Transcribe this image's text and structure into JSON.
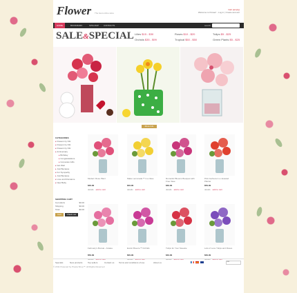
{
  "header": {
    "logo": "Flower",
    "tagline": "The best online store",
    "cart_link": "Cart (empty)",
    "welcome": "Welcome to Flower! - Log in | Create account"
  },
  "nav": {
    "items": [
      "HOME",
      "BOOKMARK",
      "SITE MAP",
      "CONTACTS"
    ],
    "search_label": "search"
  },
  "promo": {
    "title_left": "SALE",
    "ampersand": "&",
    "title_right": "SPECIAL",
    "col1": [
      {
        "label": "Lilies",
        "range": "$15 - $30"
      },
      {
        "label": "Orchids",
        "range": "$35 - $99"
      }
    ],
    "col2": [
      {
        "label": "Roses",
        "range": "$10 - $20"
      },
      {
        "label": "Tropical",
        "range": "$50 - $50"
      }
    ],
    "col3": [
      {
        "label": "Tulips",
        "range": "$5 - $25"
      },
      {
        "label": "Green Plants",
        "range": "$5 - $25"
      }
    ],
    "more_label": "More Info"
  },
  "sidebar": {
    "categories_title": "CATEGORIES",
    "categories": [
      {
        "label": "Flowers by Nbr",
        "sub": false
      },
      {
        "label": "Flowers by Nbr",
        "sub": false
      },
      {
        "label": "Flowers by Nbr",
        "sub": false
      },
      {
        "label": "Anniversary",
        "sub": false
      },
      {
        "label": "Birthday",
        "sub": true
      },
      {
        "label": "Congratulations",
        "sub": true
      },
      {
        "label": "Corporate Gifts",
        "sub": true
      },
      {
        "label": "Get Well",
        "sub": false
      },
      {
        "label": "Just Because",
        "sub": false
      },
      {
        "label": "For Sympathy",
        "sub": false
      },
      {
        "label": "Just Because",
        "sub": false
      },
      {
        "label": "Love and Romance",
        "sub": false
      },
      {
        "label": "New Baby",
        "sub": false
      }
    ],
    "cart_title": "SHOPPING CART",
    "cart_rows": [
      {
        "label": "0 products",
        "value": "$0.00"
      },
      {
        "label": "Shipping",
        "value": "$0.00"
      },
      {
        "label": "Total",
        "value": "$0.00"
      }
    ],
    "cart_btn": "Cart",
    "checkout_btn": "Check out"
  },
  "products": [
    {
      "name": "Modern Rose Plant",
      "price": "$29.99",
      "flowers": "#e0507a"
    },
    {
      "name": "Make Lemonade™ in a Vase",
      "price": "$49.99",
      "flowers": "#f2cf33"
    },
    {
      "name": "Romantic Blooms Bouquet with Free Vase",
      "price": "$39.99",
      "flowers": "#c8357a"
    },
    {
      "name": "Pink Gerbera in a Jeweled Planter",
      "price": "$59.99",
      "flowers": "#e0412f"
    },
    {
      "name": "February's Bonsai - Azalea",
      "price": "$59.99",
      "flowers": "#e56fa0"
    },
    {
      "name": "Exotic Breeze™ Orchids",
      "price": "$29.99",
      "flowers": "#c93a95"
    },
    {
      "name": "Tulips for Your Sweetie",
      "price": "$49.99",
      "flowers": "#d63245"
    },
    {
      "name": "Lots of Love Tulips and Roses",
      "price": "$39.99",
      "flowers": "#7b4dbb"
    }
  ],
  "product_buttons": {
    "details": "details",
    "add": "add to cart"
  },
  "footer": {
    "links": [
      "Specials",
      "New products",
      "Top sellers",
      "Contact us",
      "Terms and conditions of use",
      "About us"
    ],
    "copyright": "© 2011 Powered by Presta Shop™. All Rights Reserved",
    "currency": "USD"
  }
}
